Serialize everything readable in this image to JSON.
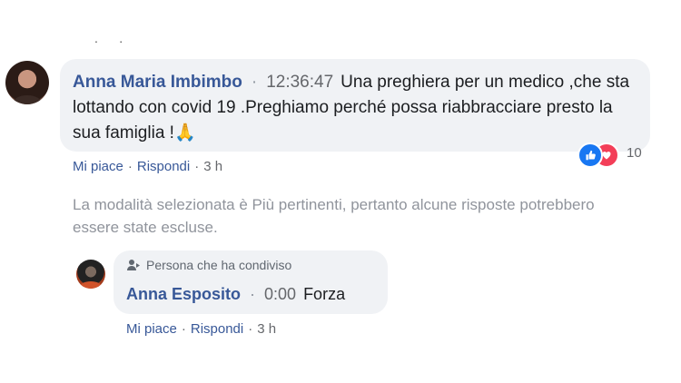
{
  "top_dots": ".      .",
  "comment": {
    "author": "Anna Maria Imbimbo",
    "separator": "·",
    "time": "12:36:47",
    "text": "Una preghiera per un medico ,che sta lottando con covid 19 .Preghiamo perché possa riabbracciare presto la sua famiglia !",
    "emoji": "🙏",
    "reactions": {
      "icons": [
        "like-icon",
        "love-icon"
      ],
      "count": "10"
    },
    "actions": {
      "like": "Mi piace",
      "reply": "Rispondi",
      "dot": "·",
      "ago": "3 h"
    }
  },
  "notice": "La modalità selezionata è Più pertinenti, pertanto alcune risposte potrebbero essere state escluse.",
  "reply": {
    "badge": "Persona che ha condiviso",
    "author": "Anna Esposito",
    "separator": "·",
    "time": "0:00",
    "text": "Forza",
    "actions": {
      "like": "Mi piace",
      "reply": "Rispondi",
      "dot": "·",
      "ago": "3 h"
    }
  },
  "colors": {
    "link": "#385898",
    "bubble": "#f0f2f5",
    "like": "#1877f2",
    "love": "#f33e58"
  }
}
